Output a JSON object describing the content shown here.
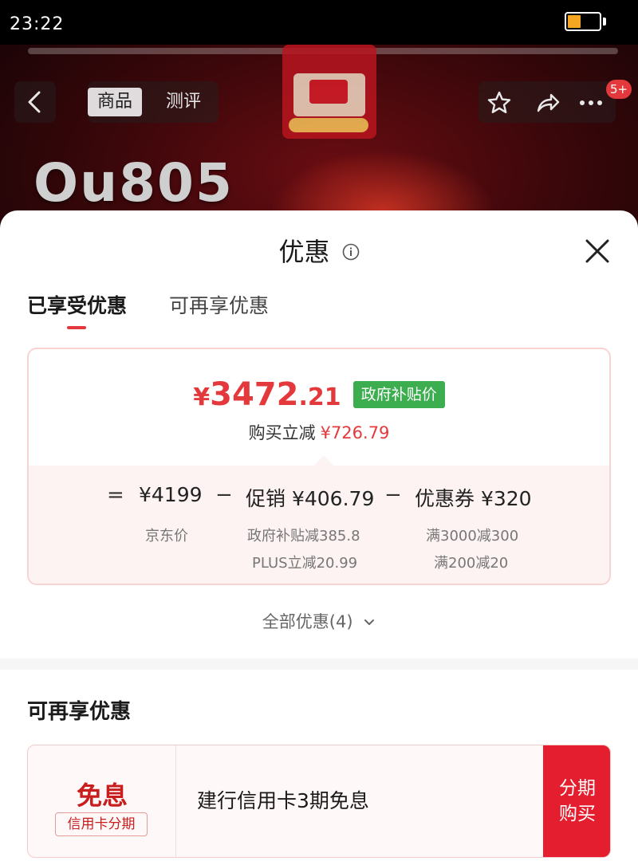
{
  "status_bar": {
    "time": "23:22"
  },
  "header": {
    "tabs": [
      {
        "label": "商品"
      },
      {
        "label": "测评"
      }
    ],
    "message_badge": "5+",
    "banner_model": "Ou805"
  },
  "sheet": {
    "title": "优惠",
    "tabs": [
      {
        "label": "已享受优惠"
      },
      {
        "label": "可再享优惠"
      }
    ],
    "price_card": {
      "currency": "¥",
      "price_int": "3472",
      "price_dec": ".21",
      "tag": "政府补贴价",
      "reduce_label": "购买立减",
      "reduce_value": "¥726.79",
      "calc": {
        "eq": "=",
        "minus": "−",
        "base_value": "¥4199",
        "base_label": "京东价",
        "promo_label": "促销",
        "promo_value": "¥406.79",
        "promo_items": [
          "政府补贴减385.8",
          "PLUS立减20.99"
        ],
        "coupon_label": "优惠券",
        "coupon_value": "¥320",
        "coupon_items": [
          "满3000减300",
          "满200减20"
        ]
      }
    },
    "all_discounts": "全部优惠(4)",
    "more_section_title": "可再享优惠",
    "offer": {
      "type": "免息",
      "tag": "信用卡分期",
      "description": "建行信用卡3期免息",
      "button_label": "分期购买"
    }
  },
  "colors": {
    "accent": "#e4393c",
    "tag_green": "#3dae4f",
    "offer_button": "#e41e2e"
  }
}
